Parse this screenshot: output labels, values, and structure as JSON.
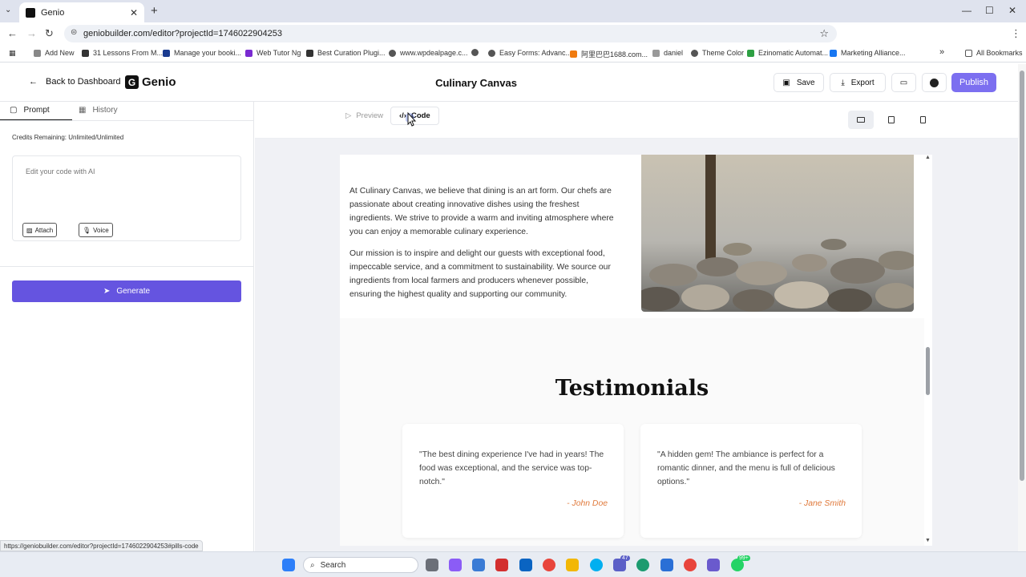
{
  "browser": {
    "tab_title": "Genio",
    "url": "geniobuilder.com/editor?projectId=1746022904253",
    "bookmarks": [
      "Add New",
      "31 Lessons From M...",
      "Manage your booki...",
      "Web Tutor Ng",
      "Best Curation Plugi...",
      "www.wpdealpage.c...",
      "",
      "Easy Forms: Advanc...",
      "阿里巴巴1688.com...",
      "daniel",
      "Theme Color",
      "Ezinomatic Automat...",
      "Marketing Alliance..."
    ],
    "all_bookmarks": "All Bookmarks",
    "status_url": "https://geniobuilder.com/editor?projectId=1746022904253#pills-code"
  },
  "header": {
    "back_label": "Back to Dashboard",
    "logo_text": "Genio",
    "project_title": "Culinary Canvas",
    "save_label": "Save",
    "export_label": "Export",
    "publish_label": "Publish"
  },
  "left_panel": {
    "tab_prompt": "Prompt",
    "tab_history": "History",
    "credits": "Credits Remaining: Unlimited/Unlimited",
    "prompt_placeholder": "Edit your code with AI",
    "attach_label": "Attach",
    "voice_label": "Voice",
    "generate_label": "Generate"
  },
  "view_toggle": {
    "preview_label": "Preview",
    "code_label": "Code"
  },
  "site": {
    "partial_heading": "— — — — — —",
    "paragraphs": [
      "At Culinary Canvas, we believe that dining is an art form. Our chefs are passionate about creating innovative dishes using the freshest ingredients. We strive to provide a warm and inviting atmosphere where you can enjoy a memorable culinary experience.",
      "Our mission is to inspire and delight our guests with exceptional food, impeccable service, and a commitment to sustainability. We source our ingredients from local farmers and producers whenever possible, ensuring the highest quality and supporting our community."
    ],
    "testimonials_title": "Testimonials",
    "testimonials": [
      {
        "quote": "\"The best dining experience I've had in years! The food was exceptional, and the service was top-notch.\"",
        "author": "- John Doe"
      },
      {
        "quote": "\"A hidden gem! The ambiance is perfect for a romantic dinner, and the menu is full of delicious options.\"",
        "author": "- Jane Smith"
      }
    ]
  },
  "taskbar": {
    "search_placeholder": "Search",
    "teams_badge": "47",
    "whatsapp_badge": "99+"
  },
  "colors": {
    "accent": "#6554e0",
    "publish": "#7c6ff0",
    "author": "#e07a3c"
  }
}
